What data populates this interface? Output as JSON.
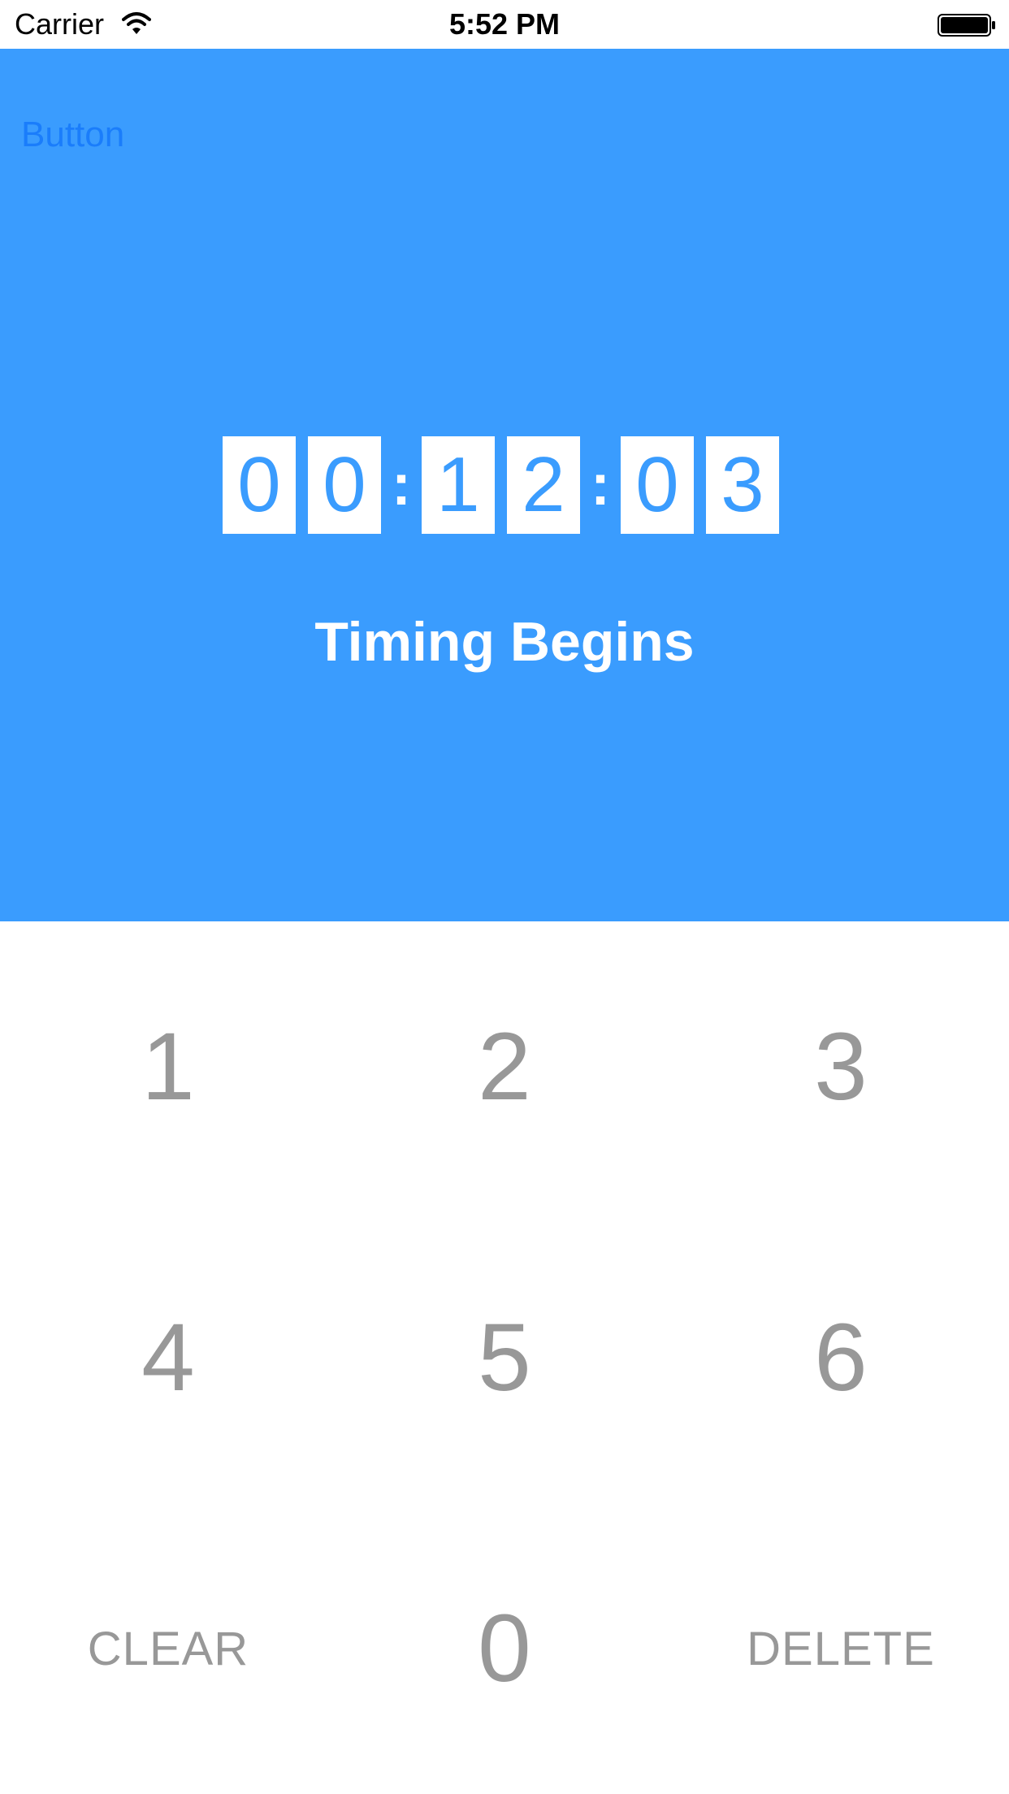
{
  "status_bar": {
    "carrier": "Carrier",
    "time": "5:52 PM",
    "wifi_icon": "wifi-icon",
    "battery_icon": "battery-icon"
  },
  "header": {
    "button_label": "Button",
    "background_color": "#3a9cfe",
    "button_color": "#1a7dfb"
  },
  "timer": {
    "digits": [
      "0",
      "0",
      "1",
      "2",
      "0",
      "3"
    ],
    "separator": ":",
    "status_label": "Timing Begins"
  },
  "keypad": {
    "text_color": "#989898",
    "keys": [
      "1",
      "2",
      "3",
      "4",
      "5",
      "6",
      "CLEAR",
      "0",
      "DELETE"
    ]
  }
}
